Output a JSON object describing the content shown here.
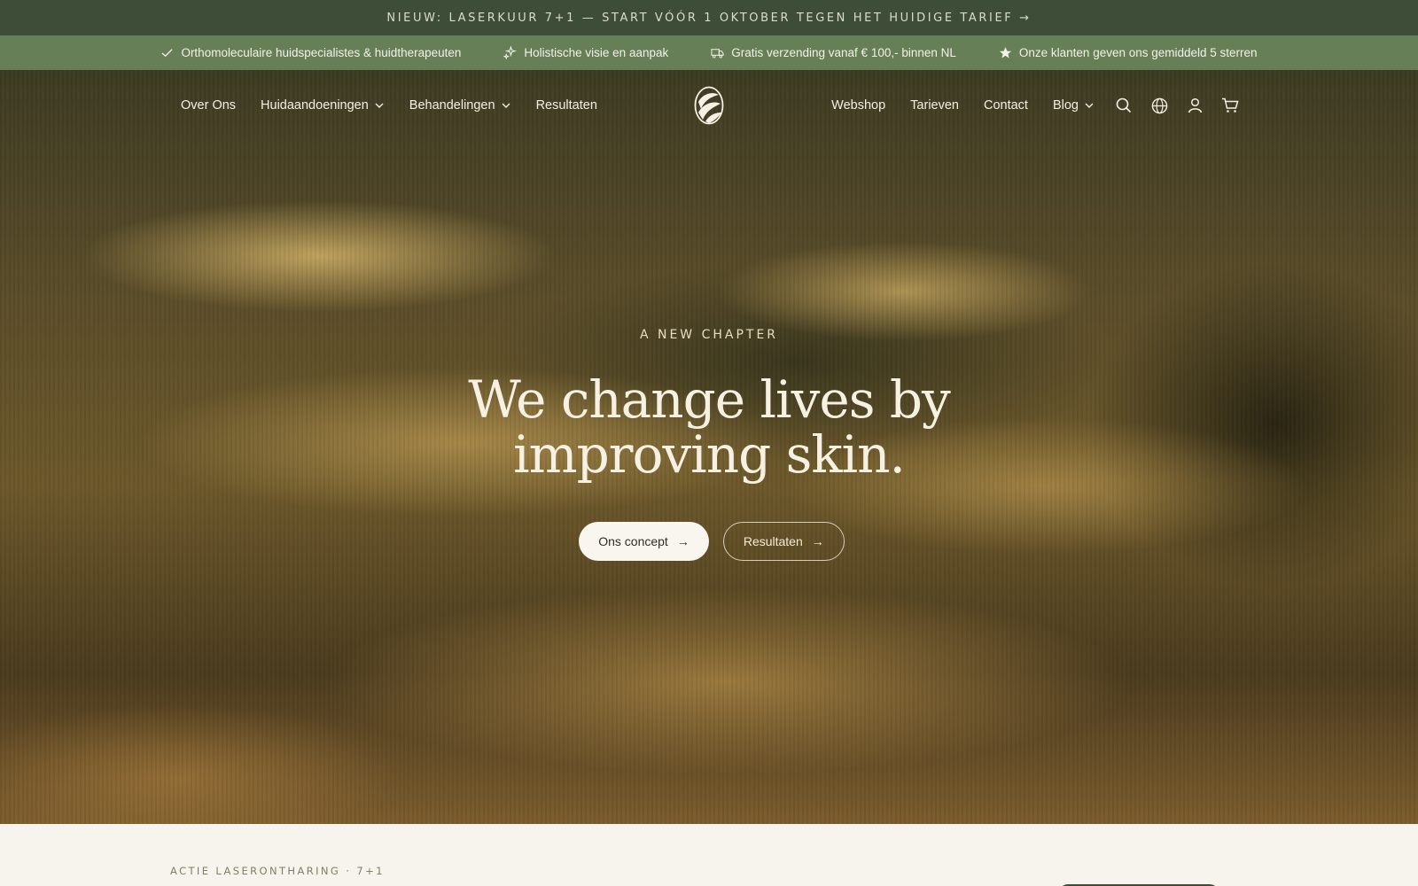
{
  "announcement": {
    "text": "NIEUW: LASERKUUR 7+1 — START VÓÓR 1 OKTOBER TEGEN HET HUIDIGE TARIEF →"
  },
  "usps": [
    {
      "icon": "check-icon",
      "label": "Orthomoleculaire huidspecialistes & huidtherapeuten"
    },
    {
      "icon": "sparkle-icon",
      "label": "Holistische visie en aanpak"
    },
    {
      "icon": "truck-icon",
      "label": "Gratis verzending vanaf € 100,- binnen NL"
    },
    {
      "icon": "star-icon",
      "label": "Onze klanten geven ons gemiddeld 5 sterren"
    }
  ],
  "nav": {
    "left": [
      {
        "label": "Over Ons",
        "dropdown": false
      },
      {
        "label": "Huidaandoeningen",
        "dropdown": true
      },
      {
        "label": "Behandelingen",
        "dropdown": true
      },
      {
        "label": "Resultaten",
        "dropdown": false
      }
    ],
    "right": [
      {
        "label": "Webshop",
        "dropdown": false
      },
      {
        "label": "Tarieven",
        "dropdown": false
      },
      {
        "label": "Contact",
        "dropdown": false
      },
      {
        "label": "Blog",
        "dropdown": true
      }
    ],
    "icons": [
      "search-icon",
      "globe-icon",
      "account-icon",
      "cart-icon"
    ]
  },
  "hero": {
    "eyebrow": "A NEW CHAPTER",
    "headline": "We change lives by improving skin.",
    "primary_button": "Ons concept",
    "secondary_button": "Resultaten"
  },
  "below": {
    "eyebrow": "ACTIE LASERONTHARING · 7+1"
  },
  "colors": {
    "announcement_bg": "#3e4d38",
    "usp_bar_bg": "#677f56",
    "page_bg": "#f6f4ec",
    "button_primary_bg": "#f8f6ef"
  }
}
